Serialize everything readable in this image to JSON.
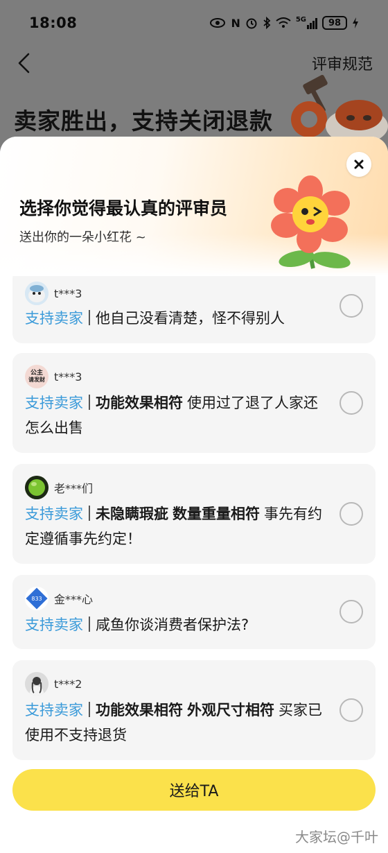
{
  "status_bar": {
    "time": "18:08",
    "signal_label": "5G",
    "battery": "98"
  },
  "page": {
    "rules_link": "评审规范",
    "verdict_title": "卖家胜出，支持关闭退款"
  },
  "sheet": {
    "title": "选择你觉得最认真的评审员",
    "subtitle": "送出你的一朵小红花 ~",
    "send_button": "送给TA"
  },
  "reviews": [
    {
      "user": "t***3",
      "avatar": "seal-avatar",
      "stance": "支持卖家",
      "tags": [],
      "text": "他自己没看清楚，怪不得别人",
      "selected": false
    },
    {
      "user": "t***3",
      "avatar": "text-avatar",
      "avatar_text_line1": "公主",
      "avatar_text_line2": "请发财",
      "stance": "支持卖家",
      "tags": [
        "功能效果相符"
      ],
      "text": "使用过了退了人家还怎么出售",
      "selected": false
    },
    {
      "user": "老***们",
      "avatar": "green-ball-avatar",
      "stance": "支持卖家",
      "tags": [
        "未隐瞒瑕疵",
        "数量重量相符"
      ],
      "text": "事先有约定遵循事先约定！",
      "selected": false
    },
    {
      "user": "金***心",
      "avatar": "badge-avatar",
      "avatar_badge_text": "833",
      "stance": "支持卖家",
      "tags": [],
      "text": "咸鱼你谈消费者保护法?",
      "selected": false
    },
    {
      "user": "t***2",
      "avatar": "photo-avatar",
      "stance": "支持卖家",
      "tags": [
        "功能效果相符",
        "外观尺寸相符"
      ],
      "text": "买家已使用不支持退货",
      "selected": false
    }
  ],
  "watermark": "大家坛@千叶",
  "colors": {
    "stance": "#3a9ad9",
    "button": "#fbe14b",
    "card": "#f5f5f5"
  }
}
